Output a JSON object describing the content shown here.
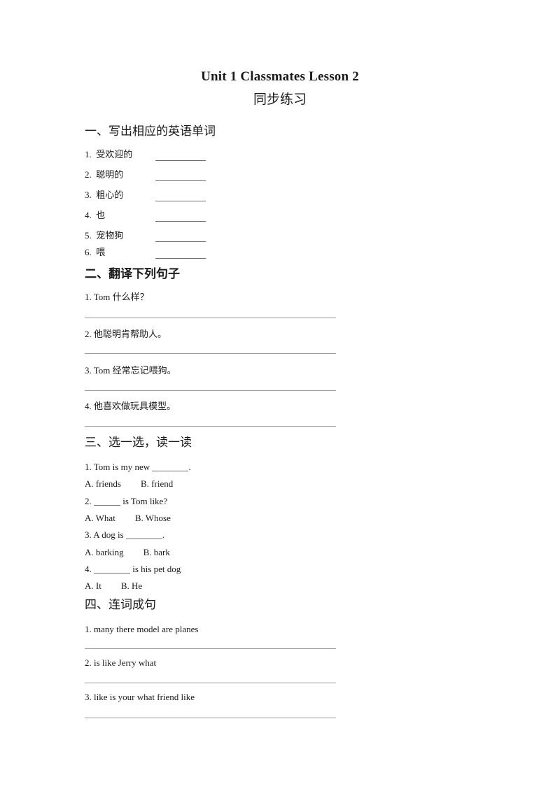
{
  "document": {
    "title": "Unit 1 Classmates Lesson 2",
    "subtitle": "同步练习"
  },
  "sections": {
    "one": {
      "heading": "一、写出相应的英语单词",
      "items": [
        {
          "number": "1.",
          "term": "受欢迎的"
        },
        {
          "number": "2.",
          "term": "聪明的"
        },
        {
          "number": "3.",
          "term": "粗心的"
        },
        {
          "number": "4.",
          "term": "也"
        },
        {
          "number": "5.",
          "term": "宠物狗"
        },
        {
          "number": "6.",
          "term": "喂"
        }
      ]
    },
    "two": {
      "heading": "二、翻译下列句子",
      "items": [
        {
          "prompt": "1. Tom 什么样？"
        },
        {
          "prompt": "2. 他聪明肯帮助人。"
        },
        {
          "prompt": "3. Tom 经常忘记喂狗。"
        },
        {
          "prompt": "4. 他喜欢做玩具模型。"
        }
      ]
    },
    "three": {
      "heading": "三、选一选，读一读",
      "items": [
        {
          "stem_before": "1. Tom is my new ",
          "stem_after": ".",
          "option_a": "A. friends",
          "option_b": "B. friend"
        },
        {
          "stem_before": "2. ",
          "stem_after": " is Tom like?",
          "option_a": "A. What",
          "option_b": "B. Whose"
        },
        {
          "stem_before": "3. A dog is ",
          "stem_after": ".",
          "option_a": "A. barking",
          "option_b": "B. bark"
        },
        {
          "stem_before": "4. ",
          "stem_after": " is his pet dog",
          "option_a": "A. It",
          "option_b": "B. He"
        }
      ]
    },
    "four": {
      "heading": "四、连词成句",
      "items": [
        {
          "prompt": "1. many there model are planes"
        },
        {
          "prompt": "2. is like Jerry what"
        },
        {
          "prompt": "3. like is your what friend like"
        }
      ]
    }
  }
}
